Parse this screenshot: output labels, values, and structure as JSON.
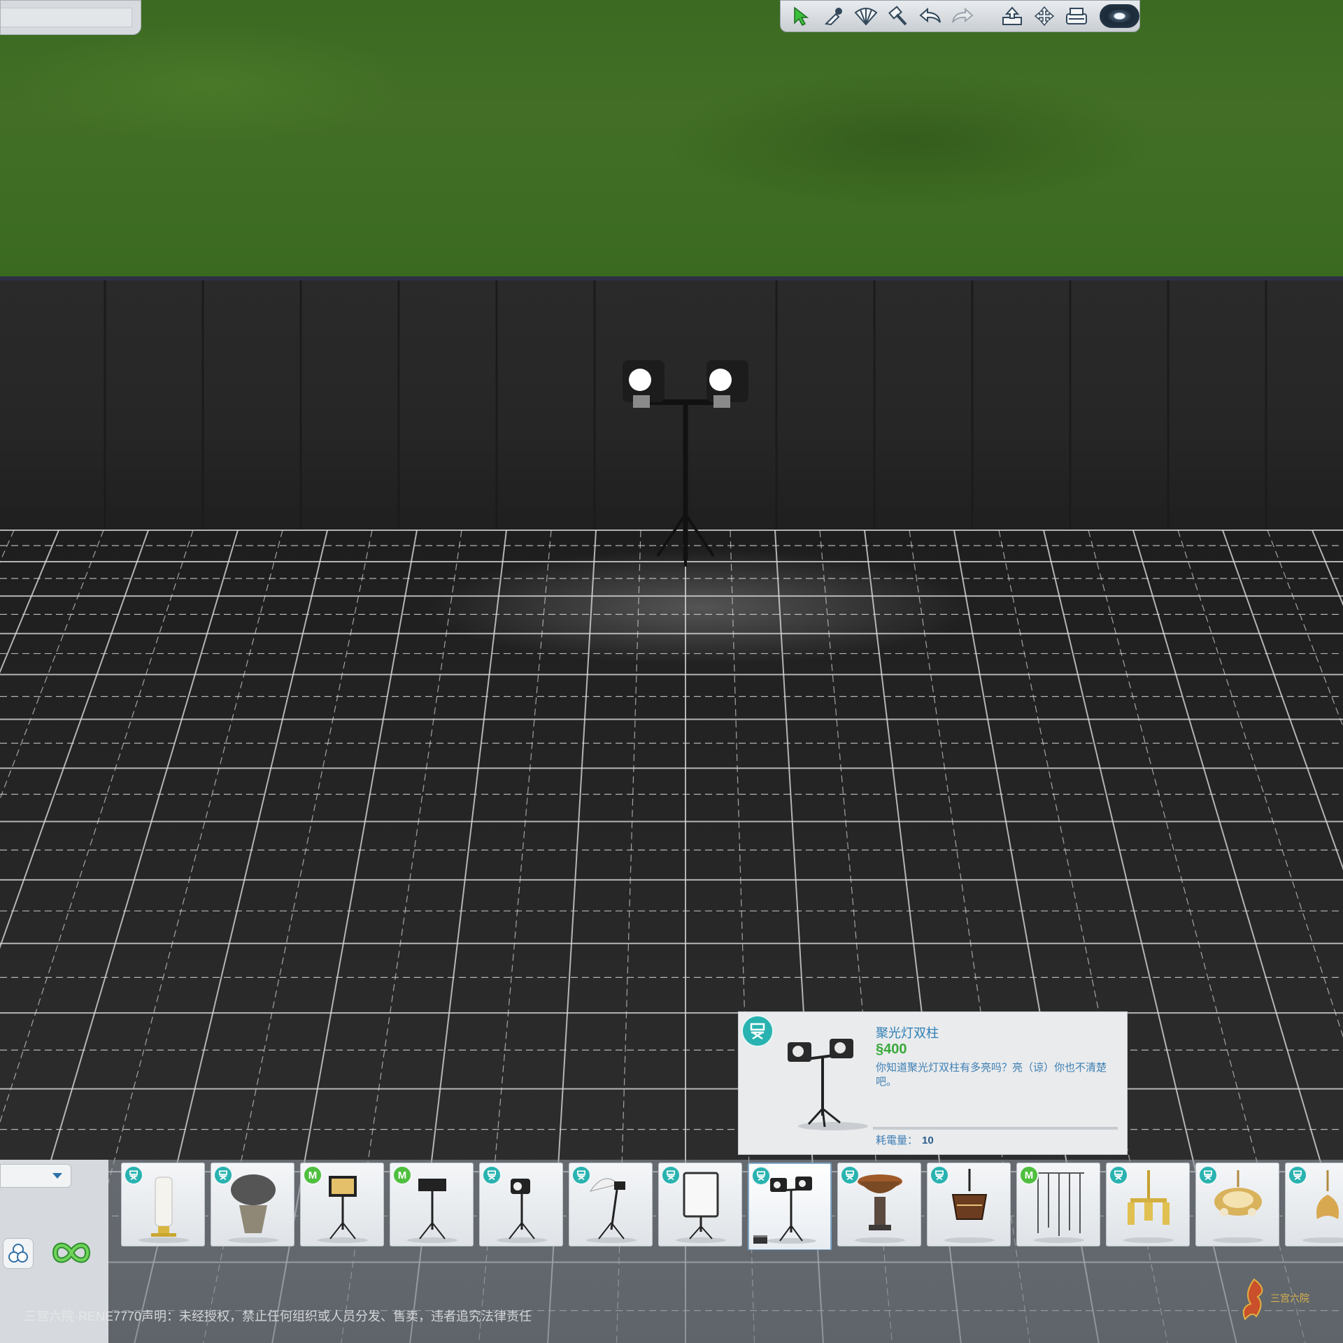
{
  "toolbar": {
    "tools": [
      {
        "name": "select-tool",
        "icon": "arrow-icon"
      },
      {
        "name": "eyedropper-tool",
        "icon": "eyedropper-icon"
      },
      {
        "name": "design-tool",
        "icon": "fan-palette-icon"
      },
      {
        "name": "sledgehammer-tool",
        "icon": "hammer-icon"
      },
      {
        "name": "undo-button",
        "icon": "undo-icon"
      },
      {
        "name": "redo-button",
        "icon": "redo-icon"
      },
      {
        "name": "save-library-button",
        "icon": "upload-icon"
      },
      {
        "name": "move-lot-button",
        "icon": "move-icon"
      },
      {
        "name": "gallery-button",
        "icon": "gallery-icon"
      },
      {
        "name": "camera-button",
        "icon": "camera-eye-icon"
      }
    ]
  },
  "tooltip": {
    "name": "聚光灯双柱",
    "currency_symbol": "§",
    "price": "400",
    "description": "你知道聚光灯双柱有多亮吗？亮（谅）你也不清楚吧。",
    "power_label": "耗電量：",
    "power_value": "10",
    "pack_badge_icon": "director-chair-icon"
  },
  "catalog": {
    "items": [
      {
        "id": "tall-white-lamp",
        "badge": "ep"
      },
      {
        "id": "round-grey-lamp",
        "badge": "ep"
      },
      {
        "id": "led-panel-stand",
        "badge": "m",
        "badge_text": "M"
      },
      {
        "id": "barn-door-stand",
        "badge": "m",
        "badge_text": "M"
      },
      {
        "id": "single-spotlight",
        "badge": "ep"
      },
      {
        "id": "umbrella-light",
        "badge": "ep"
      },
      {
        "id": "softbox-stand",
        "badge": "ep"
      },
      {
        "id": "double-spotlight",
        "badge": "ep",
        "selected": true
      },
      {
        "id": "brazier-torch",
        "badge": "ep"
      },
      {
        "id": "wooden-chandelier",
        "badge": "ep"
      },
      {
        "id": "wire-pendant-lights",
        "badge": "m",
        "badge_text": "M"
      },
      {
        "id": "gold-chandelier",
        "badge": "ep"
      },
      {
        "id": "crystal-chandelier",
        "badge": "ep"
      },
      {
        "id": "flower-chandelier",
        "badge": "ep"
      }
    ]
  },
  "footer": {
    "disclaimer": "三宫六院·RENE7770声明：未经授权，禁止任何组织或人员分发、售卖，违者追究法律责任",
    "logo_text": "三宫六院"
  },
  "colors": {
    "lawn": "#3c6a22",
    "wall": "#262626",
    "grid_line": "#d8d8d8",
    "ep_badge": "#29b3b0",
    "m_badge": "#4fbf3f",
    "tooltip_name": "#2f7fb5",
    "tooltip_price": "#3aa83a"
  }
}
